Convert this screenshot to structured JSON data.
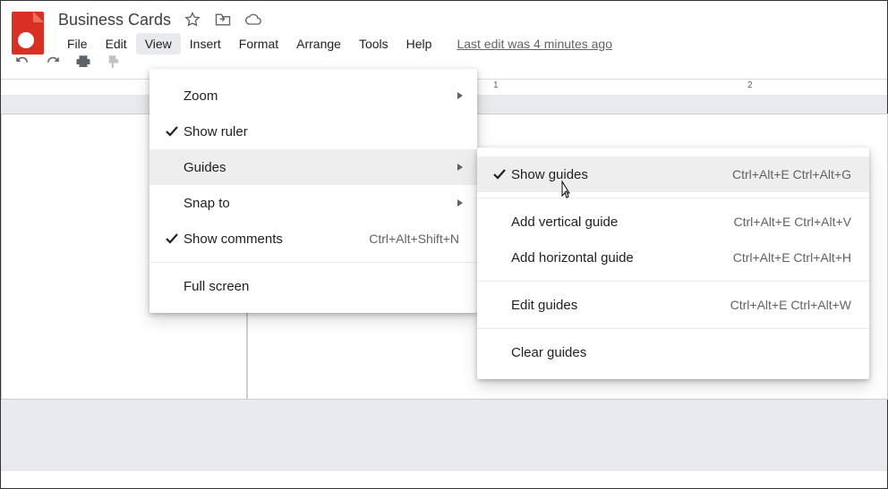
{
  "doc": {
    "title": "Business Cards"
  },
  "menubar": {
    "items": [
      "File",
      "Edit",
      "View",
      "Insert",
      "Format",
      "Arrange",
      "Tools",
      "Help"
    ],
    "active_index": 2,
    "last_edit": "Last edit was 4 minutes ago"
  },
  "ruler": {
    "marks": [
      {
        "pos": 550,
        "label": "1"
      },
      {
        "pos": 834,
        "label": "2"
      }
    ]
  },
  "view_menu": {
    "zoom": "Zoom",
    "show_ruler": "Show ruler",
    "guides": "Guides",
    "snap_to": "Snap to",
    "show_comments": "Show comments",
    "show_comments_sc": "Ctrl+Alt+Shift+N",
    "full_screen": "Full screen"
  },
  "guides_menu": {
    "show_guides": "Show guides",
    "show_guides_sc": "Ctrl+Alt+E Ctrl+Alt+G",
    "add_v": "Add vertical guide",
    "add_v_sc": "Ctrl+Alt+E Ctrl+Alt+V",
    "add_h": "Add horizontal guide",
    "add_h_sc": "Ctrl+Alt+E Ctrl+Alt+H",
    "edit": "Edit guides",
    "edit_sc": "Ctrl+Alt+E Ctrl+Alt+W",
    "clear": "Clear guides"
  }
}
